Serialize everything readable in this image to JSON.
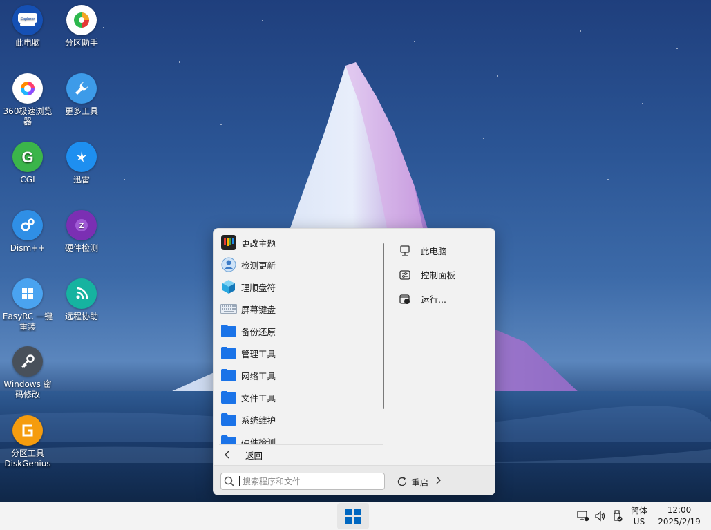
{
  "desktop": {
    "icons": [
      {
        "label": "此电脑",
        "icon": "explorer-icon",
        "badge": "Explorer"
      },
      {
        "label": "分区助手",
        "icon": "partition-assistant-icon"
      },
      {
        "label": "360极速浏览器",
        "icon": "browser-360-icon"
      },
      {
        "label": "更多工具",
        "icon": "wrench-icon"
      },
      {
        "label": "CGI",
        "icon": "cgi-icon",
        "letter": "G"
      },
      {
        "label": "迅雷",
        "icon": "thunder-icon"
      },
      {
        "label": "Dism++",
        "icon": "gears-icon"
      },
      {
        "label": "硬件检测",
        "icon": "hardware-detect-icon",
        "letter": "Z"
      },
      {
        "label": "EasyRC 一键重装",
        "icon": "windows-logo-icon"
      },
      {
        "label": "远程协助",
        "icon": "remote-assist-icon"
      },
      {
        "label": "Windows 密码修改",
        "icon": "key-icon"
      },
      {
        "label": "分区工具DiskGenius",
        "icon": "diskgenius-icon"
      }
    ]
  },
  "start_menu": {
    "apps": [
      {
        "label": "更改主题",
        "icon": "theme-icon"
      },
      {
        "label": "检测更新",
        "icon": "update-user-icon"
      },
      {
        "label": "理顺盘符",
        "icon": "cube-icon"
      },
      {
        "label": "屏幕键盘",
        "icon": "keyboard-icon"
      },
      {
        "label": "备份还原",
        "icon": "folder-icon"
      },
      {
        "label": "管理工具",
        "icon": "folder-icon"
      },
      {
        "label": "网络工具",
        "icon": "folder-icon"
      },
      {
        "label": "文件工具",
        "icon": "folder-icon"
      },
      {
        "label": "系统维护",
        "icon": "folder-icon"
      },
      {
        "label": "硬件检测",
        "icon": "folder-icon"
      }
    ],
    "right_items": [
      {
        "label": "此电脑",
        "icon": "computer-icon"
      },
      {
        "label": "控制面板",
        "icon": "control-panel-icon"
      },
      {
        "label": "运行...",
        "icon": "run-icon"
      }
    ],
    "back_label": "返回",
    "search_placeholder": "搜索程序和文件",
    "search_value": "",
    "restart_label": "重启"
  },
  "taskbar": {
    "ime_line1": "简体",
    "ime_line2": "US",
    "time": "12:00",
    "date": "2025/2/19"
  },
  "colors": {
    "folder_blue": "#1a73e8",
    "start_blue": "#0067c0"
  }
}
